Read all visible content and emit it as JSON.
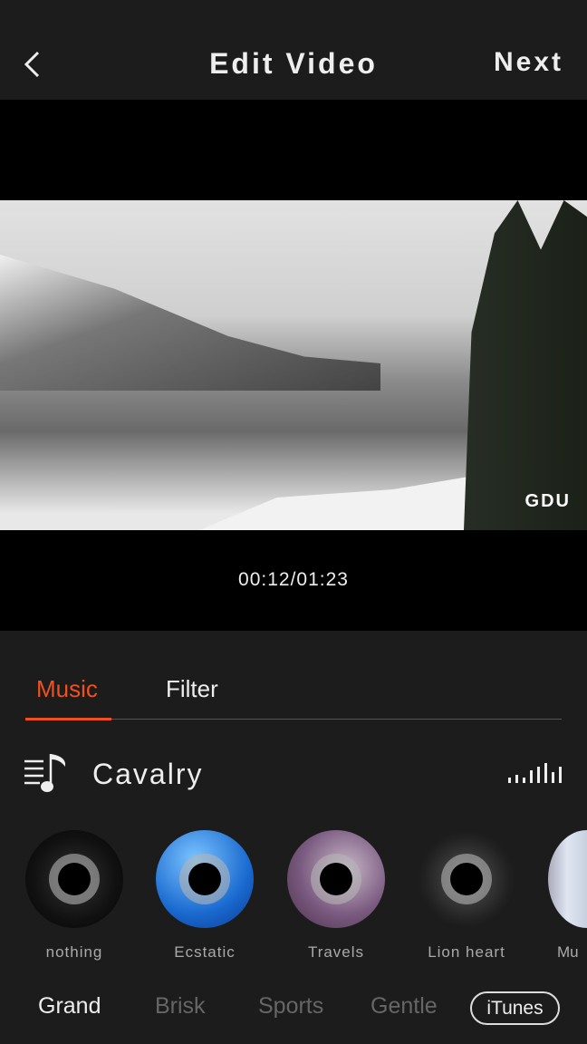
{
  "header": {
    "title": "Edit Video",
    "next_label": "Next"
  },
  "player": {
    "time": "00:12/01:23",
    "watermark": "GDU"
  },
  "tabs": [
    {
      "label": "Music",
      "active": true
    },
    {
      "label": "Filter",
      "active": false
    }
  ],
  "accent_color": "#f0501e",
  "track": {
    "name": "Cavalry"
  },
  "discs": [
    {
      "label": "nothing"
    },
    {
      "label": "Ecstatic"
    },
    {
      "label": "Travels"
    },
    {
      "label": "Lion heart"
    },
    {
      "label": "Mu"
    }
  ],
  "categories": [
    {
      "label": "Grand",
      "active": true
    },
    {
      "label": "Brisk"
    },
    {
      "label": "Sports"
    },
    {
      "label": "Gentle"
    },
    {
      "label": "iTunes"
    }
  ]
}
